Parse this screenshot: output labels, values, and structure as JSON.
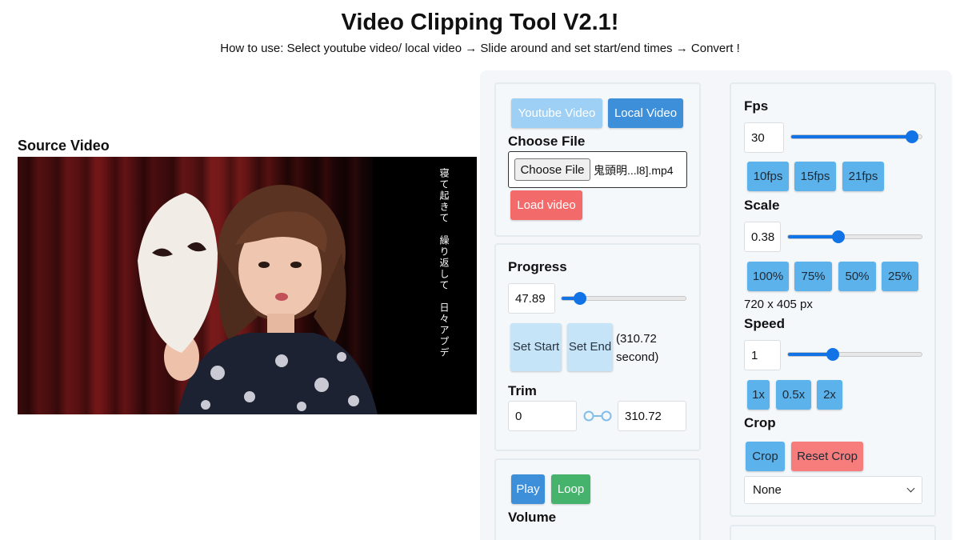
{
  "header": {
    "title": "Video Clipping Tool V2.1!",
    "howto": "How to use: Select youtube video/ local video → Slide around and set start/end times → Convert !"
  },
  "source": {
    "label": "Source Video",
    "lyrics": "寝て起きて　繰り返して　日々アプデ"
  },
  "source_panel": {
    "youtube_label": "Youtube Video",
    "local_label": "Local Video",
    "choose_file_heading": "Choose File",
    "choose_file_button": "Choose File",
    "file_name": "鬼頭明...l8].mp4",
    "load_label": "Load video"
  },
  "progress": {
    "heading": "Progress",
    "value": "47.89",
    "fraction": 0.154,
    "set_start_label": "Set Start",
    "set_end_label": "Set End",
    "duration": "(310.72 second)",
    "trim_heading": "Trim",
    "trim_start": "0",
    "trim_end": "310.72"
  },
  "playback": {
    "play_label": "Play",
    "loop_label": "Loop",
    "volume_heading": "Volume"
  },
  "fps": {
    "heading": "Fps",
    "value": "30",
    "fraction": 0.92,
    "presets": [
      "10fps",
      "15fps",
      "21fps"
    ]
  },
  "scale": {
    "heading": "Scale",
    "value": "0.38",
    "fraction": 0.38,
    "presets": [
      "100%",
      "75%",
      "50%",
      "25%"
    ],
    "dims": "720 x 405 px"
  },
  "speed": {
    "heading": "Speed",
    "value": "1",
    "fraction": 0.34,
    "presets": [
      "1x",
      "0.5x",
      "2x"
    ]
  },
  "crop": {
    "heading": "Crop",
    "crop_label": "Crop",
    "reset_label": "Reset Crop",
    "selected": "None"
  },
  "colors": {
    "accent": "#1173e6",
    "button_blue": "#3d8fd9",
    "button_red": "#f26a6a",
    "button_green": "#45b36b"
  }
}
